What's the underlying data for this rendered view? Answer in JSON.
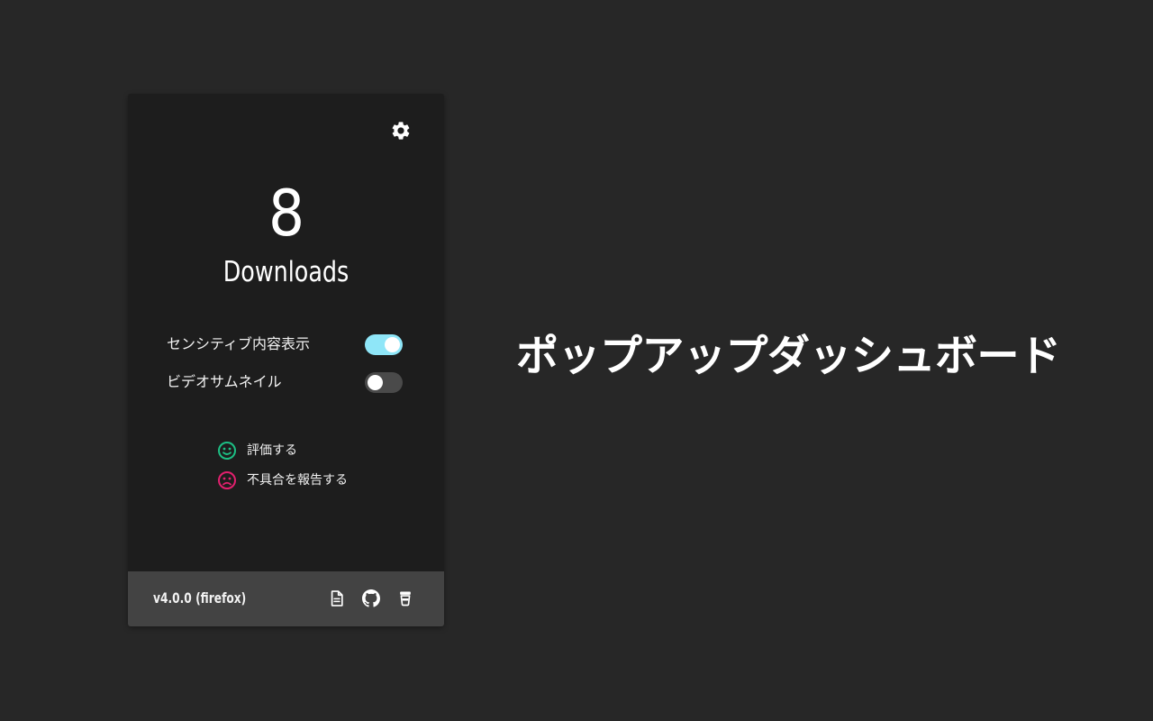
{
  "popup": {
    "download_count": "8",
    "download_label": "Downloads",
    "toggles": [
      {
        "label": "センシティブ内容表示",
        "state": "on"
      },
      {
        "label": "ビデオサムネイル",
        "state": "off"
      }
    ],
    "actions": [
      {
        "label": "評価する",
        "icon": "smile-face-icon",
        "color": "#1dbf84"
      },
      {
        "label": "不具合を報告する",
        "icon": "sad-face-icon",
        "color": "#e2206e"
      }
    ],
    "footer": {
      "version": "v4.0.0 (firefox)",
      "icons": [
        "document-icon",
        "github-icon",
        "coffee-cup-icon"
      ]
    }
  },
  "caption": "ポップアップダッシュボード",
  "colors": {
    "background": "#272727",
    "popup_background": "#1d1d1d",
    "footer_background": "#434343",
    "toggle_on": "#8fe6f8",
    "toggle_off": "#4a4a4a"
  }
}
